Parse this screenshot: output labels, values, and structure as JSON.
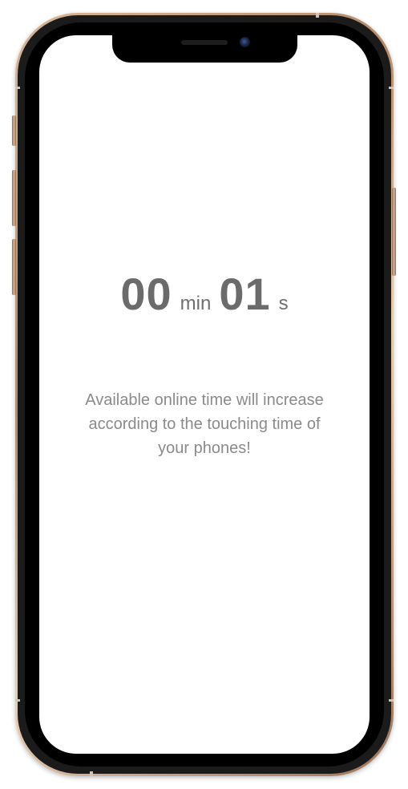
{
  "device": {
    "model": "iphone-xs",
    "frame_color": "#c79e7d",
    "bezel_color": "#000000",
    "screen_color": "#ffffff",
    "icons": {
      "camera": "front-camera-icon",
      "speaker": "earpiece-speaker-icon"
    }
  },
  "timer": {
    "minutes": "00",
    "minutes_unit": "min",
    "seconds": "01",
    "seconds_unit": "s",
    "color": "#6b6b6b"
  },
  "message": {
    "text": "Available online time will increase according to the touching time of your phones!",
    "color": "#8a8a8a"
  }
}
